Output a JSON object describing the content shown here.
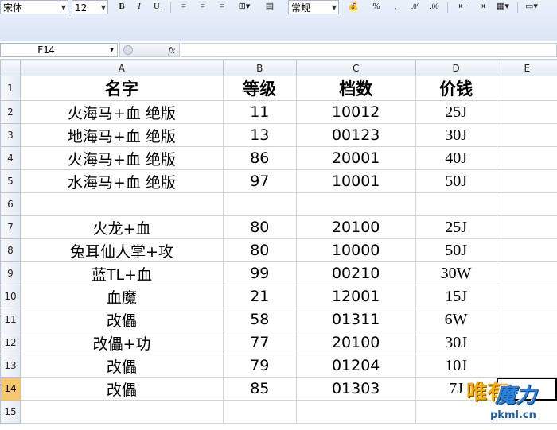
{
  "toolbar": {
    "font_name": "宋体",
    "font_size": "12",
    "bold": "B",
    "italic": "I",
    "underline": "U",
    "number_format": "常规",
    "percent": "%",
    "comma": ","
  },
  "formula_bar": {
    "cell_ref": "F14",
    "fx": "fx",
    "value": ""
  },
  "columns": [
    "A",
    "B",
    "C",
    "D",
    "E"
  ],
  "rows": [
    {
      "num": "1",
      "a": "名字",
      "b": "等级",
      "c": "档数",
      "d": "价钱"
    },
    {
      "num": "2",
      "a": "火海马+血  绝版",
      "b": "11",
      "c": "10012",
      "d": "25J"
    },
    {
      "num": "3",
      "a": "地海马+血  绝版",
      "b": "13",
      "c": "00123",
      "d": "30J"
    },
    {
      "num": "4",
      "a": "火海马+血  绝版",
      "b": "86",
      "c": "20001",
      "d": "40J"
    },
    {
      "num": "5",
      "a": "水海马+血  绝版",
      "b": "97",
      "c": "10001",
      "d": "50J"
    },
    {
      "num": "6",
      "a": "",
      "b": "",
      "c": "",
      "d": ""
    },
    {
      "num": "7",
      "a": "火龙+血",
      "b": "80",
      "c": "20100",
      "d": "25J"
    },
    {
      "num": "8",
      "a": "兔耳仙人掌+攻",
      "b": "80",
      "c": "10000",
      "d": "50J"
    },
    {
      "num": "9",
      "a": "蓝TL+血",
      "b": "99",
      "c": "00210",
      "d": "30W"
    },
    {
      "num": "10",
      "a": "血魔",
      "b": "21",
      "c": "12001",
      "d": "15J"
    },
    {
      "num": "11",
      "a": "改儡",
      "b": "58",
      "c": "01311",
      "d": "6W"
    },
    {
      "num": "12",
      "a": "改儡+功",
      "b": "77",
      "c": "20100",
      "d": "30J"
    },
    {
      "num": "13",
      "a": "改儡",
      "b": "79",
      "c": "01204",
      "d": "10J"
    },
    {
      "num": "14",
      "a": "改儡",
      "b": "85",
      "c": "01303",
      "d": "7J"
    },
    {
      "num": "15",
      "a": "",
      "b": "",
      "c": "",
      "d": ""
    }
  ],
  "watermark": {
    "char1": "唯有",
    "char2": "魔力",
    "site": "pkml.cn"
  }
}
